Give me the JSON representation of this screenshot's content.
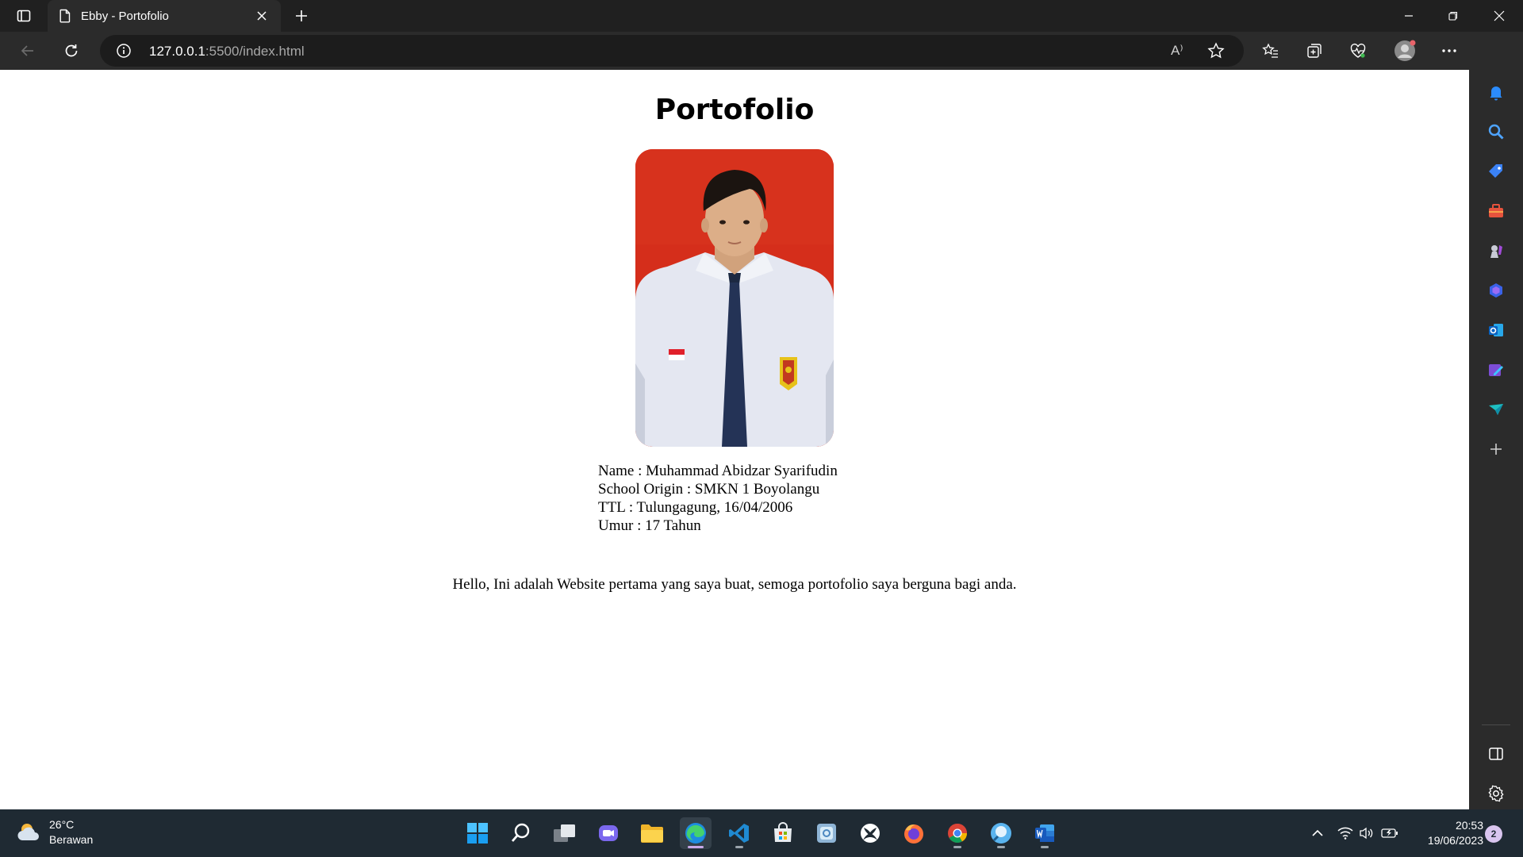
{
  "browser": {
    "tab": {
      "title": "Ebby - Portofolio",
      "icon": "page-icon"
    },
    "address": {
      "host": "127.0.0.1",
      "path": ":5500/index.html"
    },
    "read_aloud_label": "A⁾"
  },
  "page": {
    "title": "Portofolio",
    "photo_alt": "profile-photo",
    "info": [
      "Name : Muhammad Abidzar Syarifudin",
      "School Origin : SMKN 1 Boyolangu",
      "TTL : Tulungagung, 16/04/2006",
      "Umur : 17 Tahun"
    ],
    "intro": "Hello, Ini adalah Website pertama yang saya buat, semoga portofolio saya berguna bagi anda."
  },
  "sidebar": {
    "items": [
      "bell-icon",
      "search-icon",
      "shopping-tag-icon",
      "tools-icon",
      "games-icon",
      "microsoft-365-icon",
      "outlook-icon",
      "designer-icon",
      "drop-icon",
      "add-icon"
    ],
    "bottom": [
      "split-screen-icon",
      "settings-icon"
    ]
  },
  "taskbar": {
    "weather": {
      "temp": "26°C",
      "condition": "Berawan"
    },
    "apps": [
      "start",
      "search",
      "task-view",
      "teams-chat",
      "file-explorer",
      "edge",
      "vscode",
      "store",
      "photos",
      "xbox",
      "firefox",
      "chrome",
      "lens",
      "word"
    ],
    "clock": {
      "time": "20:53",
      "date": "19/06/2023"
    },
    "notification_count": "2"
  },
  "colors": {
    "chrome_dark": "#202020",
    "toolbar": "#2b2b2b",
    "page_bg": "#ffffff",
    "photo_bg": "#d62f1c",
    "taskbar": "#1f2a33"
  }
}
